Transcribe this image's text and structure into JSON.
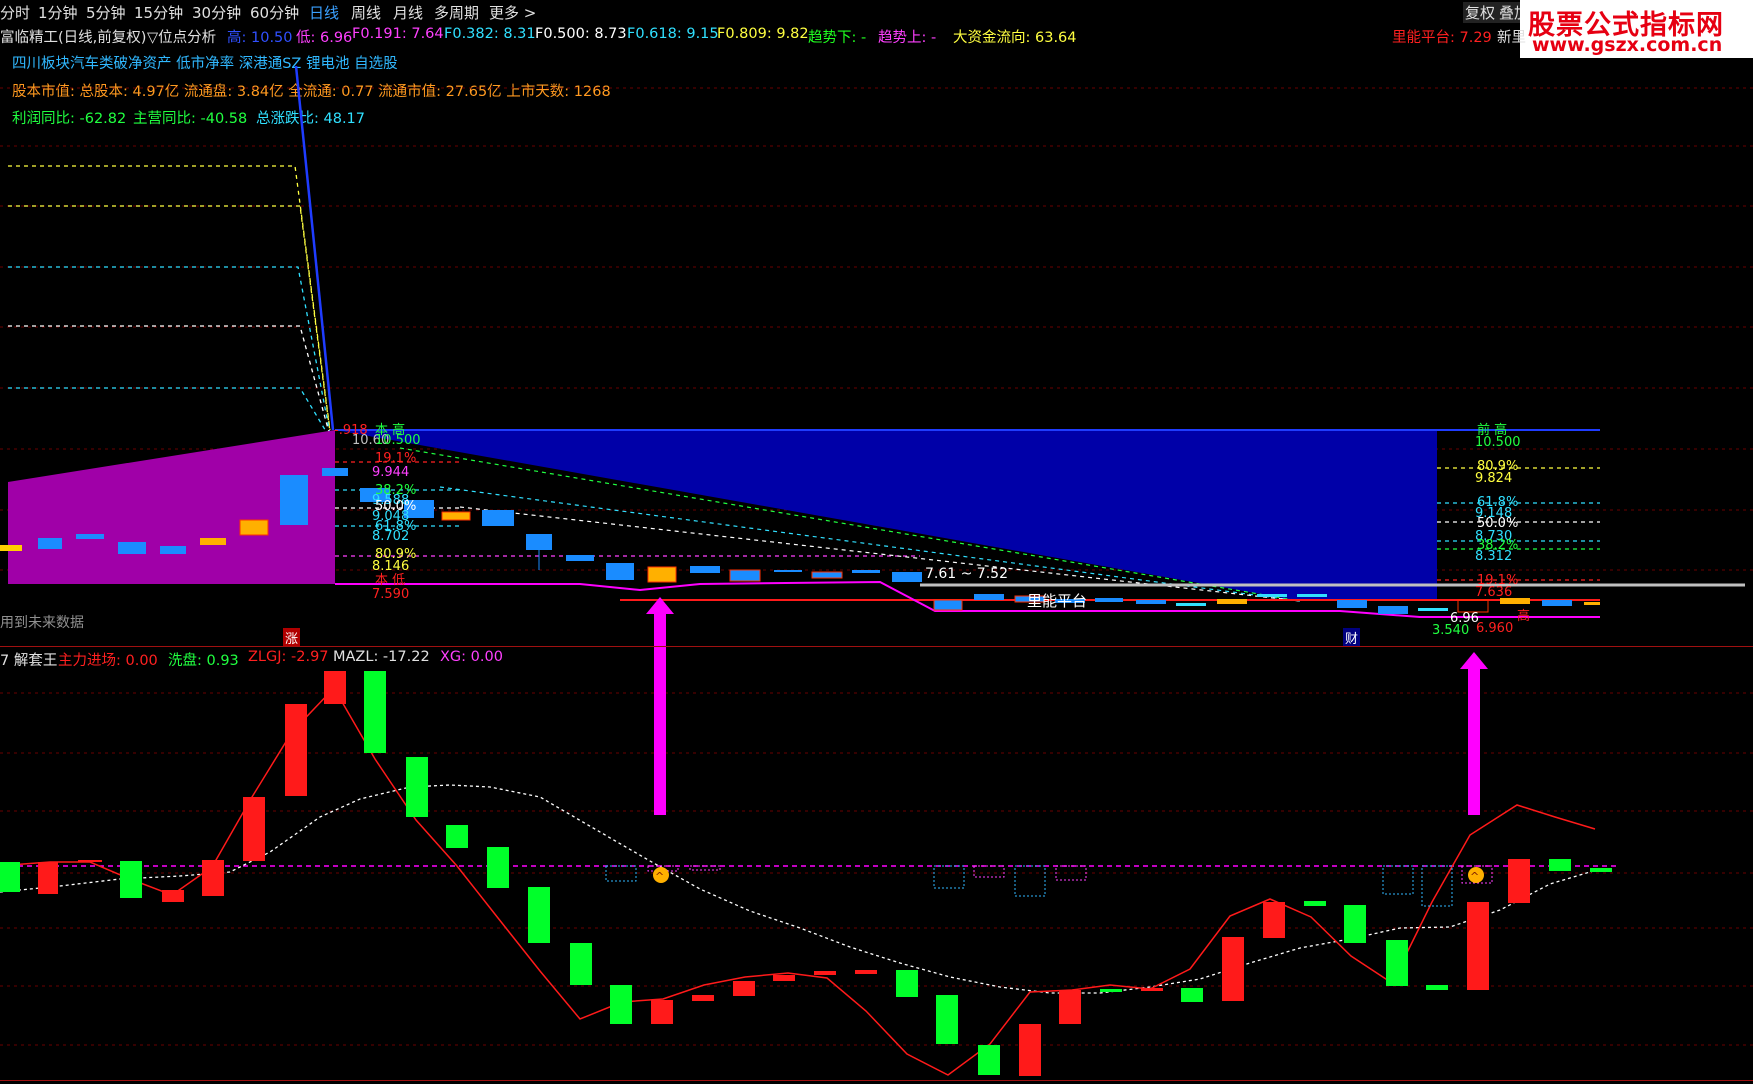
{
  "toolbar": {
    "items": [
      "分时",
      "1分钟",
      "5分钟",
      "15分钟",
      "30分钟",
      "60分钟",
      "日线",
      "周线",
      "月线",
      "多周期",
      "更多 >"
    ],
    "active": "日线",
    "right_items": [
      "复权",
      "叠加"
    ]
  },
  "brand": {
    "line1": "股票公式指标网",
    "line2": "www.gszx.com.cn"
  },
  "header": {
    "title": "富临精工(日线,前复权)",
    "analysis": "▽位点分析",
    "high_label": "高: 10.50",
    "low_label": "低: 6.96",
    "f0191": "F0.191: 7.64",
    "f0382": "F0.382: 8.31",
    "f0500": "F0.500: 8.73",
    "f0618": "F0.618: 9.15",
    "f0809": "F0.809: 9.82",
    "trend_down": "趋势下: -",
    "trend_up": "趋势上: -",
    "capital_flow": "大资金流向: 63.64",
    "energy_platform": "里能平台: 7.29",
    "new_label": "新里"
  },
  "tags_line": "四川板块汽车类破净资产 低市净率 深港通SZ 锂电池 自选股",
  "capital_line": "股本市值: 总股本: 4.97亿 流通盘: 3.84亿 全流通: 0.77 流通市值: 27.65亿 上市天数: 1268",
  "growth": {
    "profit": "利润同比: -62.82",
    "revenue": "主营同比: -40.58",
    "total": "总涨跌比: 48.17"
  },
  "left_note": "用到未来数据",
  "markers": {
    "zhang": "涨",
    "cai": "财"
  },
  "upper_chart": {
    "left_fib": {
      "top": "10.500",
      "top_val": "10.60",
      "ben_gao": "本  高",
      "p191": "19.1%",
      "v191": "9.944",
      "p382": "38.2%",
      "v382": "9.588",
      "p500": "50.0%",
      "p618": "61.8%",
      "v618": "9.048",
      "v702": "8.702",
      "p809": "80.9%",
      "v809": "8.146",
      "ben_di": "本  低",
      "v_low": "7.590",
      "left_tag": "-.918"
    },
    "range_label": "7.61 ~ 7.52",
    "platform_label": "里能平台",
    "right_fib": {
      "qian_gao": "前  高",
      "top": "10.500",
      "p809": "80.9%",
      "v809": "9.824",
      "p618": "61.8%",
      "v618": "9.148",
      "p500": "50.0%",
      "p382": "38.2%",
      "v730": "8.730",
      "v312": "8.312",
      "p191": "19.1%",
      "v636": "7.636",
      "v_low": "6.960",
      "v696": "6.96",
      "v654": "3.540",
      "di": "高"
    }
  },
  "lower_header": {
    "title": "7 解套王",
    "main_force": "主力进场: 0.00",
    "wash": "洗盘: 0.93",
    "zlgj": "ZLGJ: -2.97",
    "mazl": "MAZL: -17.22",
    "xg": "XG: 0.00"
  },
  "colors": {
    "up": "#ff1a1a",
    "down": "#00ff2a",
    "magenta": "#ff00ff",
    "blue": "#0000a8",
    "purple": "#a000a8"
  }
}
